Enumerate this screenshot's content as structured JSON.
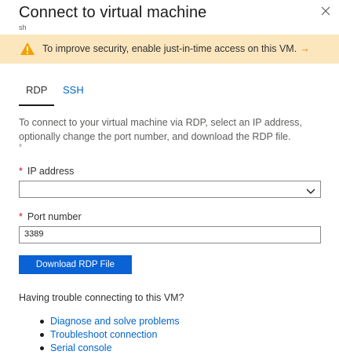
{
  "header": {
    "title": "Connect to virtual machine",
    "subtitle": "sh",
    "close_icon": "close-icon"
  },
  "banner": {
    "icon": "warning-icon",
    "text": "To improve security, enable just-in-time access on this VM.",
    "arrow": "→",
    "background_color": "#fce6be",
    "icon_color": "#f2a000",
    "arrow_color": "#e07a00"
  },
  "tabs": [
    {
      "label": "RDP",
      "selected": true
    },
    {
      "label": "SSH",
      "selected": false
    }
  ],
  "description": "To connect to your virtual machine via RDP, select an IP address, optionally change the port number, and download the RDP file.",
  "description_marker": "°",
  "form": {
    "required_marker": "*",
    "ip_address": {
      "label": "IP address",
      "value": ""
    },
    "port_number": {
      "label": "Port number",
      "value": "3389"
    }
  },
  "download_button": {
    "label": "Download RDP File",
    "color": "#0a62d4"
  },
  "trouble": {
    "heading": "Having trouble connecting to this VM?",
    "links": [
      "Diagnose and solve problems",
      "Troubleshoot connection",
      "Serial console"
    ]
  },
  "colors": {
    "link": "#0066cc",
    "required": "#c50f1f"
  }
}
